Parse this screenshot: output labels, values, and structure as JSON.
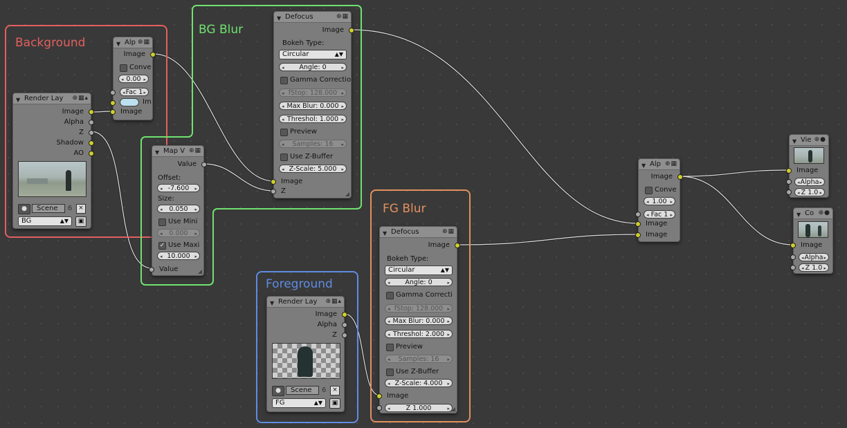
{
  "frames": {
    "background": "Background",
    "bg_blur": "BG Blur",
    "foreground": "Foreground",
    "fg_blur": "FG Blur"
  },
  "colors": {
    "background_frame": "#e35f5f",
    "bg_blur_frame": "#6fe26f",
    "foreground_frame": "#5f8ce3",
    "fg_blur_frame": "#e3905f",
    "socket_color": "#cfcf2a",
    "socket_gray": "#a8a8a8"
  },
  "render_layer_bg": {
    "title": "Render Lay",
    "outputs": [
      "Image",
      "Alpha",
      "Z",
      "Shadow",
      "AO"
    ],
    "scene": "Scene",
    "scene_users": "6",
    "layer": "BG"
  },
  "alpha_over_bg": {
    "title": "Alp",
    "output": "Image",
    "convert": "Conve",
    "value": "0.00",
    "fac": "Fac 1",
    "input_im": "Im",
    "input_image": "Image"
  },
  "map_value": {
    "title": "Map V",
    "output": "Value",
    "offset_label": "Offset:",
    "offset": "-7.600",
    "size_label": "Size:",
    "size": "0.050",
    "use_min": "Use Mini",
    "min_value": "0.000",
    "use_max": "Use Maxi",
    "max_value": "10.000",
    "input": "Value"
  },
  "defocus_bg": {
    "title": "Defocus",
    "output": "Image",
    "bokeh_label": "Bokeh Type:",
    "bokeh": "Circular",
    "angle": "Angle: 0",
    "gamma": "Gamma Correctio",
    "fstop": "fStop: 128.000",
    "max_blur": "Max Blur: 0.000",
    "threshold": "Threshol: 1.000",
    "preview": "Preview",
    "samples": "Samples: 16",
    "use_zbuffer": "Use Z-Buffer",
    "zscale": "Z-Scale: 5.000",
    "input_image": "Image",
    "input_z": "Z"
  },
  "render_layer_fg": {
    "title": "Render Lay",
    "outputs": [
      "Image",
      "Alpha",
      "Z"
    ],
    "scene": "Scene",
    "scene_users": "6",
    "layer": "FG"
  },
  "defocus_fg": {
    "title": "Defocus",
    "output": "Image",
    "bokeh_label": "Bokeh Type:",
    "bokeh": "Circular",
    "angle": "Angle: 0",
    "gamma": "Gamma Correcti",
    "fstop": "fStop: 128.000",
    "max_blur": "Max Blur: 0.000",
    "threshold": "Threshol: 2.000",
    "preview": "Preview",
    "samples": "Samples: 16",
    "use_zbuffer": "Use Z-Buffer",
    "zscale": "Z-Scale: 4.000",
    "input_image": "Image",
    "input_z": "Z 1.000"
  },
  "alpha_over_main": {
    "title": "Alp",
    "output": "Image",
    "convert": "Conve",
    "value": "1.00",
    "fac": "Fac 1",
    "input_image1": "Image",
    "input_image2": "Image"
  },
  "viewer": {
    "title": "Vie",
    "input_image": "Image",
    "alpha": "Alpha",
    "z": "Z 1.0"
  },
  "composite": {
    "title": "Co",
    "input_image": "Image",
    "alpha": "Alpha",
    "z": "Z 1.0"
  }
}
